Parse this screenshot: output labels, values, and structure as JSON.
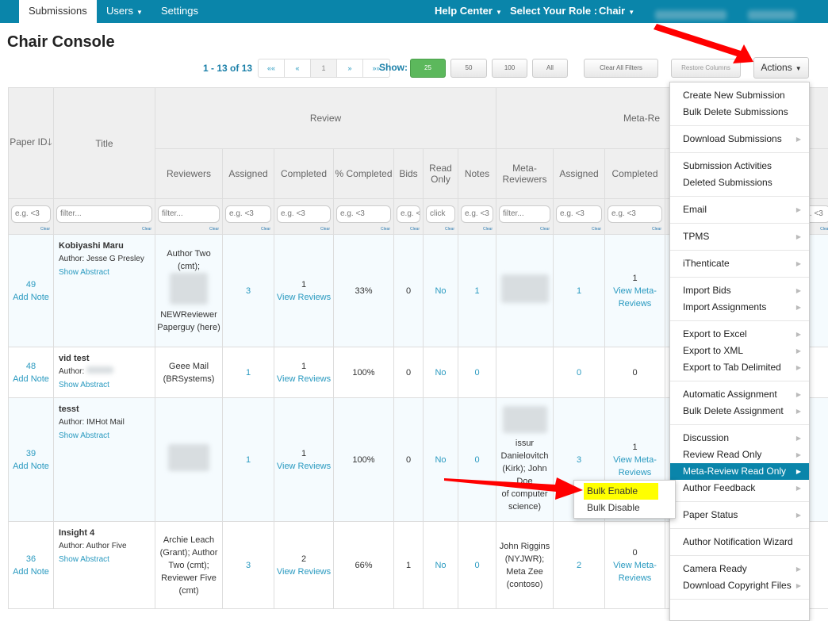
{
  "nav": {
    "submissions": "Submissions",
    "users": "Users",
    "settings": "Settings",
    "help": "Help Center",
    "role_label": "Select Your Role :",
    "role": "Chair"
  },
  "page_title": "Chair Console",
  "pagination": {
    "range": "1 - 13 of 13",
    "first": "««",
    "prev": "«",
    "current": "1",
    "next": "»",
    "last": "»»",
    "show_label": "Show:",
    "sizes": [
      "25",
      "50",
      "100",
      "All"
    ],
    "selected": "25"
  },
  "toolbar": {
    "clear_filters": "Clear All Filters",
    "restore_columns": "Restore Columns",
    "actions": "Actions"
  },
  "table": {
    "group_headers": {
      "review": "Review",
      "meta_review": "Meta-Re"
    },
    "headers": {
      "paper_id": "Paper ID",
      "title": "Title",
      "reviewers": "Reviewers",
      "assigned": "Assigned",
      "completed": "Completed",
      "pct_completed": "% Completed",
      "bids": "Bids",
      "read_only": "Read Only",
      "notes": "Notes",
      "meta_reviewers": "Meta-Reviewers",
      "meta_assigned": "Assigned",
      "meta_completed": "Completed",
      "partial": "es"
    },
    "filters": {
      "num": "e.g. <3",
      "text": "filter...",
      "click": "click",
      "clear": "Clear"
    },
    "rows": [
      {
        "id": "49",
        "add_note": "Add Note",
        "title": "Kobiyashi Maru",
        "author": "Author: Jesse G Presley",
        "show_abstract": "Show Abstract",
        "reviewers_a": "Author Two (cmt);",
        "reviewers_b": "NEWReviewer Paperguy (here)",
        "assigned": "3",
        "completed": "1",
        "view": "View Reviews",
        "pct": "33%",
        "bids": "0",
        "read_only": "No",
        "notes": "1",
        "meta_reviewers": "",
        "meta_assigned": "1",
        "meta_completed": "1",
        "meta_view": "View Meta-Reviews"
      },
      {
        "id": "48",
        "add_note": "Add Note",
        "title": "vid test",
        "author": "Author:",
        "show_abstract": "Show Abstract",
        "reviewers_a": "Geee Mail (BRSystems)",
        "reviewers_b": "",
        "assigned": "1",
        "completed": "1",
        "view": "View Reviews",
        "pct": "100%",
        "bids": "0",
        "read_only": "No",
        "notes": "0",
        "meta_reviewers": "",
        "meta_assigned": "0",
        "meta_completed": "0",
        "meta_view": ""
      },
      {
        "id": "39",
        "add_note": "Add Note",
        "title": "tesst",
        "author": "Author: IMHot Mail",
        "show_abstract": "Show Abstract",
        "reviewers_a": "",
        "reviewers_b": "",
        "assigned": "1",
        "completed": "1",
        "view": "View Reviews",
        "pct": "100%",
        "bids": "0",
        "read_only": "No",
        "notes": "0",
        "meta_reviewers": "issur Danielovitch (Kirk); John Doe",
        "meta_reviewers_b": "of computer science)",
        "meta_assigned": "3",
        "meta_completed": "1",
        "meta_view": "View Meta-Reviews"
      },
      {
        "id": "36",
        "add_note": "Add Note",
        "title": "Insight 4",
        "author": "Author: Author Five",
        "show_abstract": "Show Abstract",
        "reviewers_a": "Archie Leach (Grant); Author Two (cmt); Reviewer Five (cmt)",
        "reviewers_b": "",
        "assigned": "3",
        "completed": "2",
        "view": "View Reviews",
        "pct": "66%",
        "bids": "1",
        "read_only": "No",
        "notes": "0",
        "meta_reviewers": "John Riggins (NYJWR); Meta Zee (contoso)",
        "meta_assigned": "2",
        "meta_completed": "0",
        "meta_view": "View Meta-Reviews"
      }
    ]
  },
  "actions_menu": {
    "groups": [
      [
        "Create New Submission",
        "Bulk Delete Submissions"
      ],
      [
        "Download Submissions"
      ],
      [
        "Submission Activities",
        "Deleted Submissions"
      ],
      [
        "Email"
      ],
      [
        "TPMS"
      ],
      [
        "iThenticate"
      ],
      [
        "Import Bids",
        "Import Assignments"
      ],
      [
        "Export to Excel",
        "Export to XML",
        "Export to Tab Delimited"
      ],
      [
        "Automatic Assignment",
        "Bulk Delete Assignment"
      ],
      [
        "Discussion",
        "Review Read Only",
        "Meta-Review Read Only",
        "Author Feedback"
      ],
      [
        "Paper Status"
      ],
      [
        "Author Notification Wizard"
      ],
      [
        "Camera Ready",
        "Download Copyright Files"
      ]
    ],
    "highlighted": "Meta-Review Read Only"
  },
  "submenu": {
    "enable": "Bulk Enable",
    "disable": "Bulk Disable"
  },
  "colors": {
    "nav": "#0a85aa",
    "link": "#2a9ac0",
    "active_size": "#5cb85c",
    "highlight": "#ffff00",
    "arrow": "#ff0000"
  }
}
